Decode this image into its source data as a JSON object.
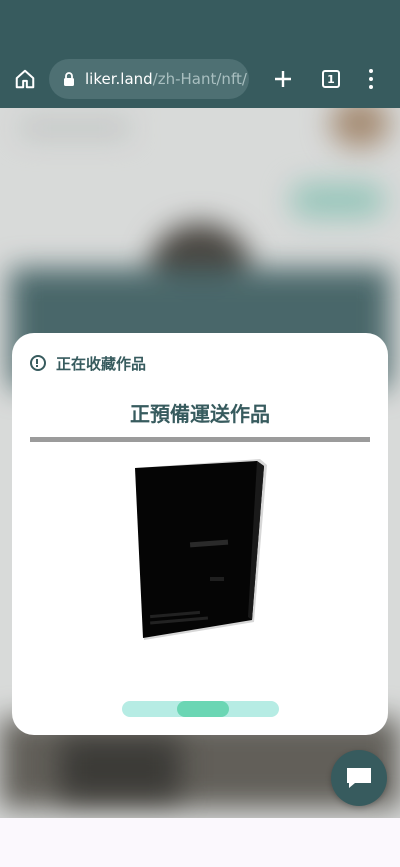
{
  "browser": {
    "url_host": "liker.land",
    "url_path": "/zh-Hant/nft/",
    "tab_count": "1",
    "icons": {
      "home": "home-icon",
      "lock": "lock-icon",
      "new_tab": "plus-icon",
      "tabs": "tab-switcher-icon",
      "menu": "more-vert-icon"
    }
  },
  "modal": {
    "header_text": "正在收藏作品",
    "title": "正預備運送作品",
    "progress": 0.35,
    "colors": {
      "accent": "#375b5e",
      "progress_track": "#b6ece4",
      "progress_fill": "#6bd6b4"
    }
  },
  "chat": {
    "icon": "chat-bubble-icon"
  }
}
